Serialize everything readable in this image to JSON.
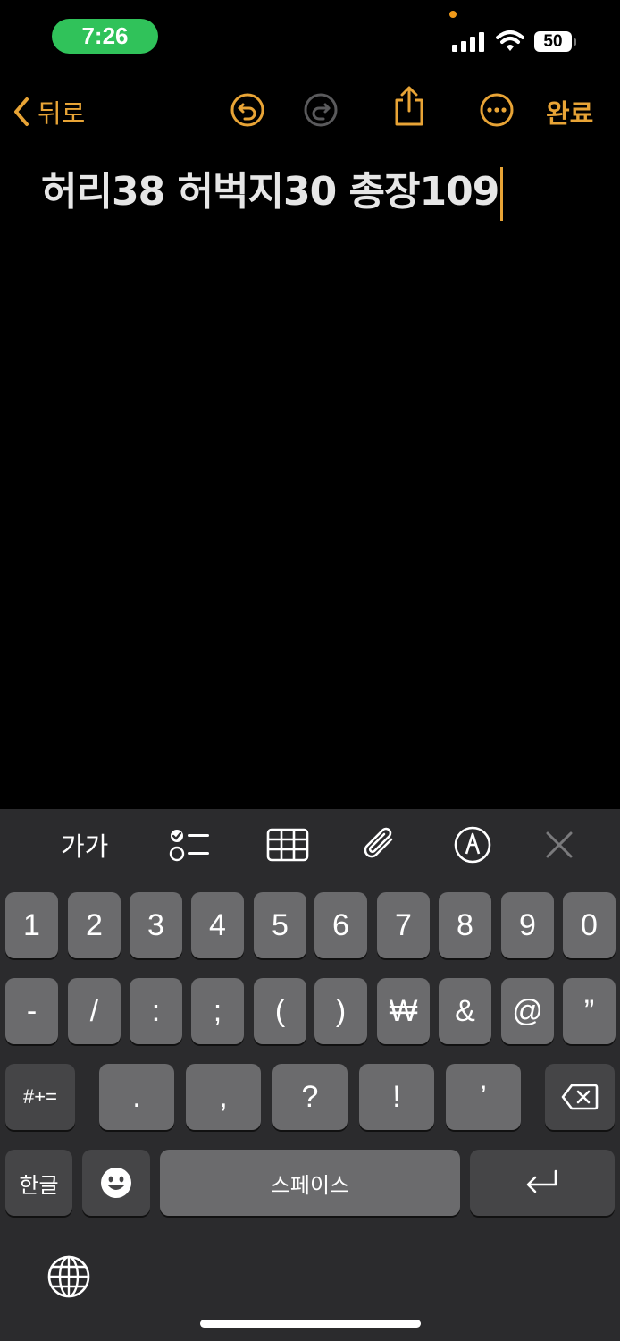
{
  "status_bar": {
    "time": "7:26",
    "battery": "50"
  },
  "nav": {
    "back_label": "뒤로",
    "done_label": "완료"
  },
  "note": {
    "text": "허리38 허벅지30 총장109"
  },
  "toolbar": {
    "format_label": "가가"
  },
  "keyboard": {
    "row1": [
      "1",
      "2",
      "3",
      "4",
      "5",
      "6",
      "7",
      "8",
      "9",
      "0"
    ],
    "row2": [
      "-",
      "/",
      ":",
      ";",
      "(",
      ")",
      "₩",
      "&",
      "@",
      "”"
    ],
    "row3": [
      "#+=",
      ".",
      ",",
      "?",
      "!",
      "’"
    ],
    "hangul_label": "한글",
    "space_label": "스페이스"
  },
  "colors": {
    "accent": "#e8a436",
    "time_pill": "#30c25a",
    "key": "#6b6b6d",
    "key_dark": "#454547",
    "keyboard_bg": "#2b2b2d"
  }
}
